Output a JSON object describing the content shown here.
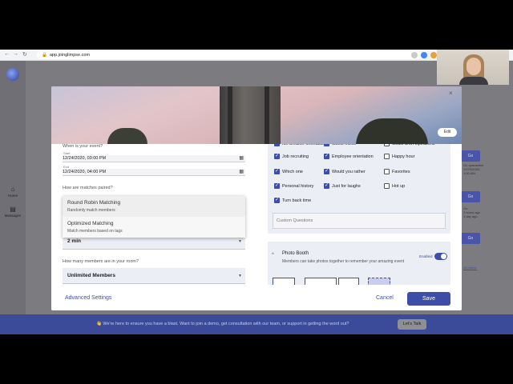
{
  "browser": {
    "url": "app.joinglimpse.com",
    "nav_back": "←",
    "nav_forward": "→",
    "nav_reload": "↻",
    "lock": "🔒",
    "extension_colors": [
      "#c9c9c9",
      "#4285f4",
      "#8e8e8e",
      "#e8a13a"
    ]
  },
  "app": {
    "logo": "glimpse-logo",
    "sidebar": [
      {
        "icon": "home-icon",
        "glyph": "⌂",
        "label": "Home"
      },
      {
        "icon": "messages-icon",
        "glyph": "▤",
        "label": "Messages"
      }
    ],
    "background": {
      "buttons": [
        "Go",
        "Go",
        "Go"
      ],
      "snippets": [
        [
          "Go quarantine",
          "12/23/2020,",
          "1:00 AM"
        ],
        [
          "Go",
          "2 hours ago",
          "1 day ago"
        ],
        [
          "All rooms"
        ]
      ]
    },
    "banner": {
      "text": "👋 We're here to ensure you have a blast. Want to join a demo, get consultation with our team, or support in getting the word out?",
      "button": "Let's Talk"
    }
  },
  "modal": {
    "close_glyph": "×",
    "edit_label": "Edit",
    "event_question": "When is your event?",
    "start_label": "Start",
    "start_value": "12/24/2020, 03:00 PM",
    "end_label": "End",
    "end_value": "12/24/2020, 04:00 PM",
    "calendar_glyph": "▦",
    "match_question": "How are matches paired?",
    "match_options": [
      {
        "title": "Round Robin Matching",
        "desc": "Randomly match members",
        "highlighted": true
      },
      {
        "title": "Optimized Matching",
        "desc": "Match members based on tags",
        "highlighted": false
      }
    ],
    "duration_value": "2 min",
    "members_question": "How many members are in your room?",
    "members_value": "Unlimited Members",
    "arrow_glyph": "▼",
    "prompts": [
      {
        "label": "Ice-breaker orientation",
        "checked": true
      },
      {
        "label": "Guest Intros",
        "checked": true
      },
      {
        "label": "Goals and Aspirations",
        "checked": false
      },
      {
        "label": "Job recruiting",
        "checked": true
      },
      {
        "label": "Employee orientation",
        "checked": true
      },
      {
        "label": "Happy hour",
        "checked": false
      },
      {
        "label": "Which one",
        "checked": true
      },
      {
        "label": "Would you rather",
        "checked": true
      },
      {
        "label": "Favorites",
        "checked": false
      },
      {
        "label": "Personal history",
        "checked": true
      },
      {
        "label": "Just for laughs",
        "checked": true
      },
      {
        "label": "Hot up",
        "checked": false
      },
      {
        "label": "Turn back time",
        "checked": true
      }
    ],
    "check_glyph": "✓",
    "custom_placeholder": "Custom Questions",
    "photo_booth": {
      "chevron": "^",
      "title": "Photo Booth",
      "desc": "Members can take photos together to remember your amazing event",
      "status": "Enabled",
      "enabled": true
    },
    "footer": {
      "advanced": "Advanced Settings",
      "cancel": "Cancel",
      "save": "Save"
    }
  }
}
